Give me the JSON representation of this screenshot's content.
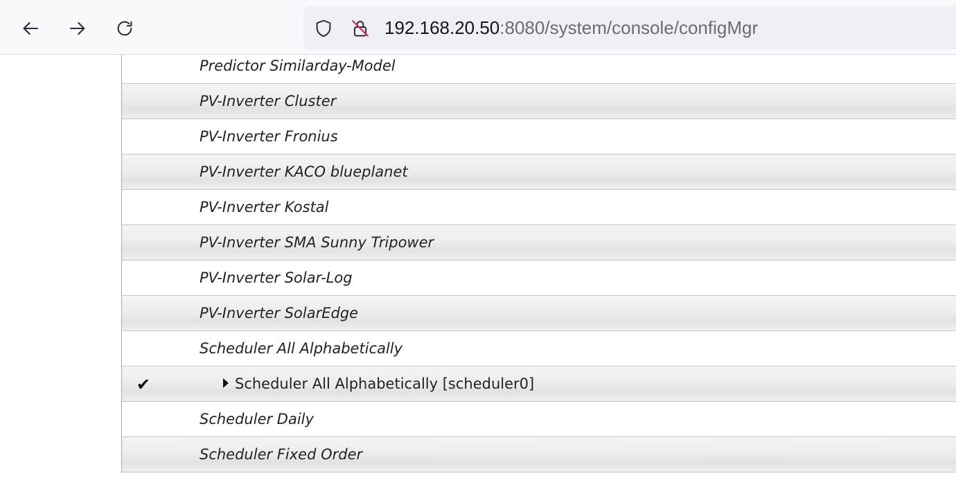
{
  "toolbar": {
    "back_icon": "back-arrow-icon",
    "forward_icon": "forward-arrow-icon",
    "reload_icon": "reload-icon"
  },
  "urlbar": {
    "host": "192.168.20.50",
    "rest": ":8080/system/console/configMgr",
    "shield_icon": "tracking-shield-icon",
    "lock_icon": "insecure-lock-icon"
  },
  "rows": [
    {
      "label": "Predictor Similarday-Model",
      "kind": "factory"
    },
    {
      "label": "PV-Inverter Cluster",
      "kind": "factory"
    },
    {
      "label": "PV-Inverter Fronius",
      "kind": "factory"
    },
    {
      "label": "PV-Inverter KACO blueplanet",
      "kind": "factory"
    },
    {
      "label": "PV-Inverter Kostal",
      "kind": "factory"
    },
    {
      "label": "PV-Inverter SMA Sunny Tripower",
      "kind": "factory"
    },
    {
      "label": "PV-Inverter Solar-Log",
      "kind": "factory"
    },
    {
      "label": "PV-Inverter SolarEdge",
      "kind": "factory"
    },
    {
      "label": "Scheduler All Alphabetically",
      "kind": "factory"
    },
    {
      "label": "Scheduler All Alphabetically [scheduler0]",
      "kind": "instance",
      "check": "✔"
    },
    {
      "label": "Scheduler Daily",
      "kind": "factory"
    },
    {
      "label": "Scheduler Fixed Order",
      "kind": "factory"
    }
  ]
}
